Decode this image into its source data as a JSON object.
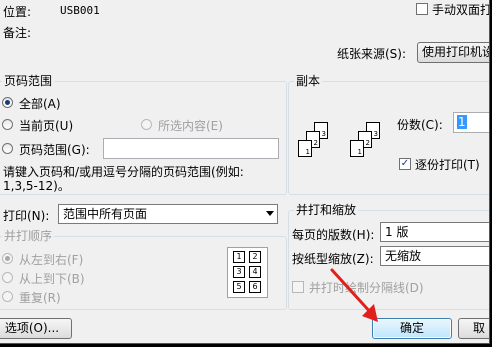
{
  "header": {
    "location_label": "位置:",
    "location_value": "USB001",
    "comment_label": "备注:",
    "manual_duplex_label": "手动双面打",
    "paper_source_label": "纸张来源(S):",
    "paper_source_value": "使用打印机设"
  },
  "page_range": {
    "title": "页码范围",
    "all": "全部(A)",
    "current": "当前页(U)",
    "selection": "所选内容(E)",
    "range": "页码范围(G):",
    "range_value": "",
    "hint_line1": "请键入页码和/或用逗号分隔的页码范围(例如:",
    "hint_line2": "1,3,5-12)。"
  },
  "copies": {
    "title": "副本",
    "count_label": "份数(C):",
    "count_value": "1",
    "collate_label": "逐份打印(T)",
    "collate_checked": "✓",
    "stack1": [
      "3",
      "2",
      "1"
    ],
    "stack2": [
      "3",
      "2",
      "1"
    ]
  },
  "print_what": {
    "label": "打印(N):",
    "value": "范围中所有页面"
  },
  "order": {
    "title": "并打顺序",
    "left_to_right": "从左到右(F)",
    "top_to_bottom": "从上到下(B)",
    "repeat": "重复(R)",
    "grid": [
      "1",
      "2",
      "3",
      "4",
      "5",
      "6"
    ]
  },
  "zoom": {
    "title": "并打和缩放",
    "pages_per_sheet_label": "每页的版数(H):",
    "pages_per_sheet_value": "1 版",
    "scale_label": "按纸型缩放(Z):",
    "scale_value": "无缩放",
    "separator_label": "并打时绘制分隔线(D)"
  },
  "footer": {
    "options_button": "选项(O)...",
    "ok_button": "确定",
    "cancel_button": "取"
  },
  "annotation_color": "#e0201c"
}
